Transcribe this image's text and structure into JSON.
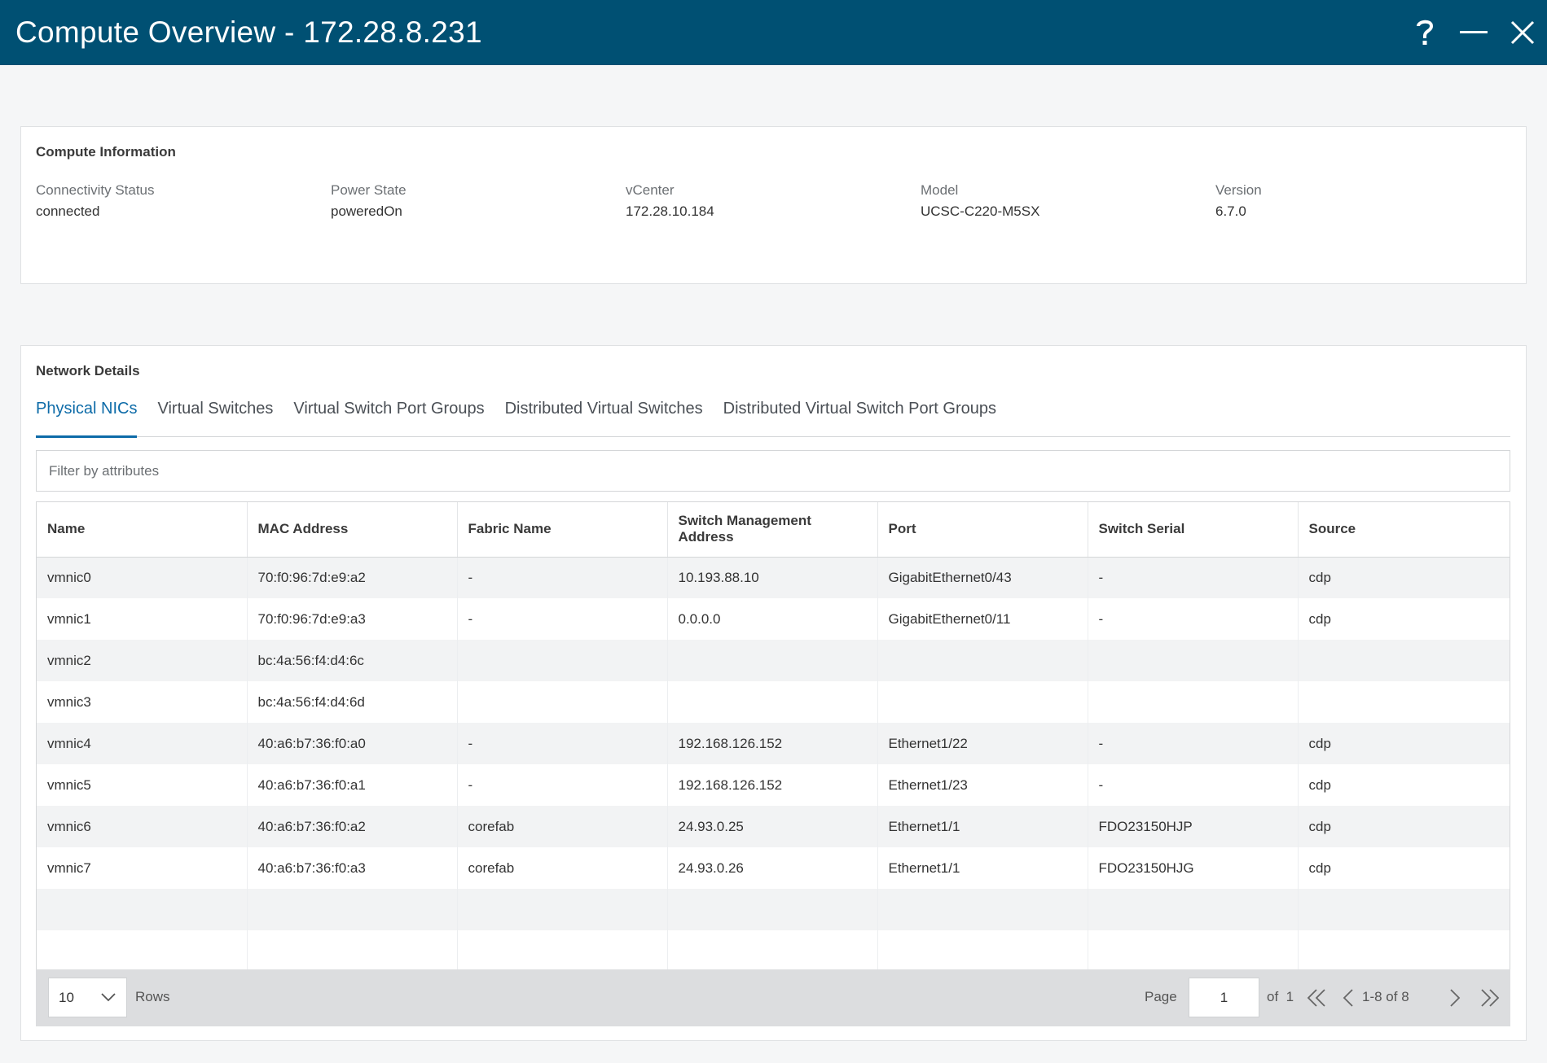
{
  "window": {
    "title": "Compute Overview - 172.28.8.231",
    "help_icon": "question-mark-icon",
    "minimize_icon": "minimize-icon",
    "close_icon": "close-icon",
    "accent_color": "#005073"
  },
  "compute_info": {
    "title": "Compute Information",
    "fields": [
      {
        "label": "Connectivity Status",
        "value": "connected"
      },
      {
        "label": "Power State",
        "value": "poweredOn"
      },
      {
        "label": "vCenter",
        "value": "172.28.10.184"
      },
      {
        "label": "Model",
        "value": "UCSC-C220-M5SX"
      },
      {
        "label": "Version",
        "value": "6.7.0"
      }
    ]
  },
  "network": {
    "title": "Network Details",
    "tabs": [
      {
        "label": "Physical NICs",
        "active": true
      },
      {
        "label": "Virtual Switches",
        "active": false
      },
      {
        "label": "Virtual Switch Port Groups",
        "active": false
      },
      {
        "label": "Distributed Virtual Switches",
        "active": false
      },
      {
        "label": "Distributed Virtual Switch Port Groups",
        "active": false
      }
    ],
    "filter_placeholder": "Filter by attributes",
    "columns": [
      "Name",
      "MAC Address",
      "Fabric Name",
      "Switch Management Address",
      "Port",
      "Switch Serial",
      "Source"
    ],
    "rows": [
      [
        "vmnic0",
        "70:f0:96:7d:e9:a2",
        "-",
        "10.193.88.10",
        "GigabitEthernet0/43",
        "-",
        "cdp"
      ],
      [
        "vmnic1",
        "70:f0:96:7d:e9:a3",
        "-",
        "0.0.0.0",
        "GigabitEthernet0/11",
        "-",
        "cdp"
      ],
      [
        "vmnic2",
        "bc:4a:56:f4:d4:6c",
        "",
        "",
        "",
        "",
        ""
      ],
      [
        "vmnic3",
        "bc:4a:56:f4:d4:6d",
        "",
        "",
        "",
        "",
        ""
      ],
      [
        "vmnic4",
        "40:a6:b7:36:f0:a0",
        "-",
        "192.168.126.152",
        "Ethernet1/22",
        "-",
        "cdp"
      ],
      [
        "vmnic5",
        "40:a6:b7:36:f0:a1",
        "-",
        "192.168.126.152",
        "Ethernet1/23",
        "-",
        "cdp"
      ],
      [
        "vmnic6",
        "40:a6:b7:36:f0:a2",
        "corefab",
        "24.93.0.25",
        "Ethernet1/1",
        "FDO23150HJP",
        "cdp"
      ],
      [
        "vmnic7",
        "40:a6:b7:36:f0:a3",
        "corefab",
        "24.93.0.26",
        "Ethernet1/1",
        "FDO23150HJG",
        "cdp"
      ],
      [
        "",
        "",
        "",
        "",
        "",
        "",
        ""
      ],
      [
        "",
        "",
        "",
        "",
        "",
        "",
        ""
      ]
    ],
    "pagination": {
      "rows_per_page": "10",
      "rows_label": "Rows",
      "page_label": "Page",
      "page_value": "1",
      "of_label": "of",
      "total_pages": "1",
      "range_label": "1-8 of 8",
      "first_icon": "double-chevron-left-icon",
      "prev_icon": "chevron-left-icon",
      "next_icon": "chevron-right-icon",
      "last_icon": "double-chevron-right-icon"
    }
  }
}
